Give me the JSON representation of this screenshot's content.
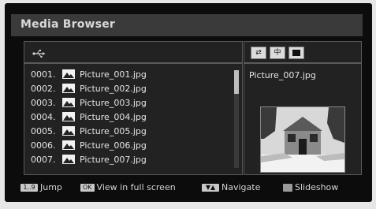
{
  "title": "Media Browser",
  "device_icon": "usb-icon",
  "files": [
    {
      "num": "0001.",
      "name": "Picture_001.jpg",
      "icon": "image-icon"
    },
    {
      "num": "0002.",
      "name": "Picture_002.jpg",
      "icon": "image-icon"
    },
    {
      "num": "0003.",
      "name": "Picture_003.jpg",
      "icon": "image-icon"
    },
    {
      "num": "0004.",
      "name": "Picture_004.jpg",
      "icon": "image-icon"
    },
    {
      "num": "0005.",
      "name": "Picture_005.jpg",
      "icon": "image-icon"
    },
    {
      "num": "0006.",
      "name": "Picture_006.jpg",
      "icon": "image-icon"
    },
    {
      "num": "0007.",
      "name": "Picture_007.jpg",
      "icon": "image-icon"
    }
  ],
  "selected_file": "Picture_007.jpg",
  "mode_buttons": [
    {
      "icon": "shuffle-icon",
      "label": "⇄"
    },
    {
      "icon": "folder-icon",
      "label": "中"
    },
    {
      "icon": "stop-icon",
      "label": ""
    }
  ],
  "footer": {
    "jump_key": "1..9",
    "jump_label": "Jump",
    "ok_key": "OK",
    "ok_label": "View in full screen",
    "nav_key": "▼▲",
    "nav_label": "Navigate",
    "slideshow_label": "Slideshow"
  }
}
